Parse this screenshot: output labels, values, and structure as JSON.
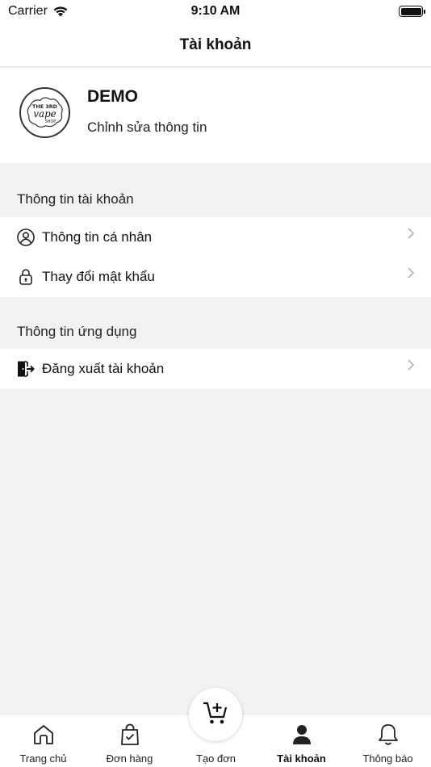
{
  "status_bar": {
    "carrier": "Carrier",
    "time": "9:10 AM"
  },
  "nav": {
    "title": "Tài khoản"
  },
  "profile": {
    "name": "DEMO",
    "edit_label": "Chỉnh sửa thông tin",
    "avatar_logo": "THE 3RD vape SHOP"
  },
  "sections": [
    {
      "title": "Thông tin tài khoản",
      "items": [
        {
          "label": "Thông tin cá nhân",
          "icon": "user-circle-icon"
        },
        {
          "label": "Thay đổi mật khẩu",
          "icon": "lock-icon"
        }
      ]
    },
    {
      "title": "Thông tin ứng dụng",
      "items": [
        {
          "label": "Đăng xuất tài khoản",
          "icon": "logout-icon"
        }
      ]
    }
  ],
  "tabbar": {
    "items": [
      {
        "label": "Trang chủ",
        "icon": "home-icon",
        "active": false
      },
      {
        "label": "Đơn hàng",
        "icon": "shopping-bag-icon",
        "active": false
      },
      {
        "label": "Tạo đơn",
        "icon": "cart-add-icon",
        "active": false
      },
      {
        "label": "Tài khoản",
        "icon": "user-icon",
        "active": true
      },
      {
        "label": "Thông báo",
        "icon": "bell-icon",
        "active": false
      }
    ]
  },
  "colors": {
    "background": "#f2f2f2",
    "surface": "#ffffff",
    "text": "#111111"
  }
}
